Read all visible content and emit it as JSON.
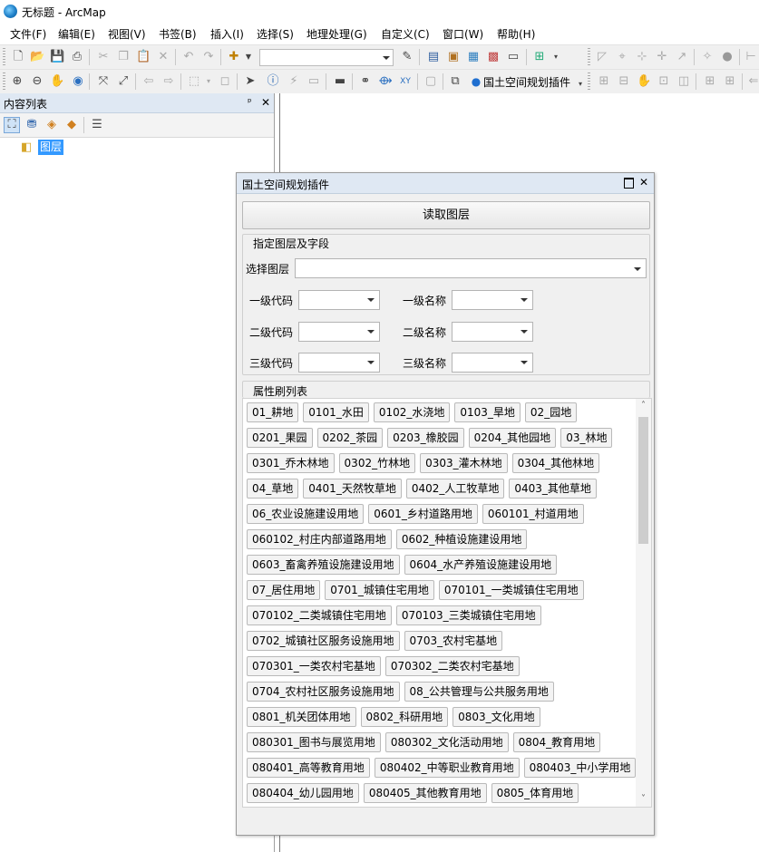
{
  "window": {
    "title": "无标题 - ArcMap"
  },
  "menu": [
    "文件(F)",
    "编辑(E)",
    "视图(V)",
    "书签(B)",
    "插入(I)",
    "选择(S)",
    "地理处理(G)",
    "自定义(C)",
    "窗口(W)",
    "帮助(H)"
  ],
  "toolbar2": {
    "plugin_label": "国土空间规划插件"
  },
  "toc": {
    "title": "内容列表",
    "pin": "ᵖ",
    "close": "✕",
    "layer_root": "图层"
  },
  "plugin": {
    "title": "国土空间规划插件",
    "read_button": "读取图层",
    "group1_title": "指定图层及字段",
    "select_layer_label": "选择图层",
    "level1_code_label": "一级代码",
    "level1_name_label": "一级名称",
    "level2_code_label": "二级代码",
    "level2_name_label": "二级名称",
    "level3_code_label": "三级代码",
    "level3_name_label": "三级名称",
    "group2_title": "属性刷列表",
    "chip_rows": [
      [
        "01_耕地",
        "0101_水田",
        "0102_水浇地",
        "0103_旱地",
        "02_园地"
      ],
      [
        "0201_果园",
        "0202_茶园",
        "0203_橡胶园",
        "0204_其他园地",
        "03_林地"
      ],
      [
        "0301_乔木林地",
        "0302_竹林地",
        "0303_灌木林地",
        "0304_其他林地"
      ],
      [
        "04_草地",
        "0401_天然牧草地",
        "0402_人工牧草地",
        "0403_其他草地"
      ],
      [
        "06_农业设施建设用地",
        "0601_乡村道路用地",
        "060101_村道用地"
      ],
      [
        "060102_村庄内部道路用地",
        "0602_种植设施建设用地"
      ],
      [
        "0603_畜禽养殖设施建设用地",
        "0604_水产养殖设施建设用地"
      ],
      [
        "07_居住用地",
        "0701_城镇住宅用地",
        "070101_一类城镇住宅用地"
      ],
      [
        "070102_二类城镇住宅用地",
        "070103_三类城镇住宅用地"
      ],
      [
        "0702_城镇社区服务设施用地",
        "0703_农村宅基地"
      ],
      [
        "070301_一类农村宅基地",
        "070302_二类农村宅基地"
      ],
      [
        "0704_农村社区服务设施用地",
        "08_公共管理与公共服务用地"
      ],
      [
        "0801_机关团体用地",
        "0802_科研用地",
        "0803_文化用地"
      ],
      [
        "080301_图书与展览用地",
        "080302_文化活动用地",
        "0804_教育用地"
      ],
      [
        "080401_高等教育用地",
        "080402_中等职业教育用地",
        "080403_中小学用地"
      ],
      [
        "080404_幼儿园用地",
        "080405_其他教育用地",
        "0805_体育用地"
      ]
    ]
  }
}
